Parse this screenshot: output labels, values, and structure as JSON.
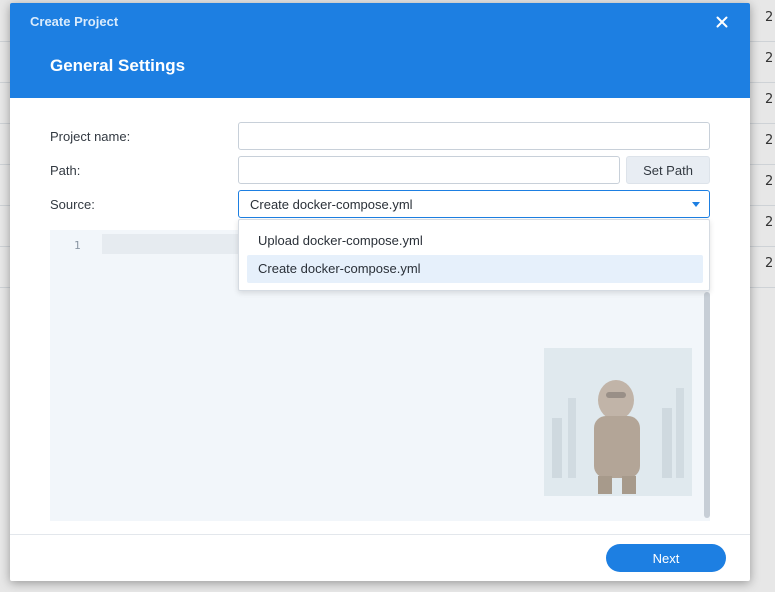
{
  "background": {
    "row_values": [
      "2",
      "2",
      "2",
      "2",
      "2",
      "2",
      "2"
    ]
  },
  "dialog": {
    "title": "Create Project",
    "section_title": "General Settings",
    "close_icon": "close-icon"
  },
  "form": {
    "project_name": {
      "label": "Project name:",
      "value": "",
      "placeholder": ""
    },
    "path": {
      "label": "Path:",
      "value": "",
      "placeholder": "",
      "set_path_label": "Set Path"
    },
    "source": {
      "label": "Source:",
      "selected": "Create docker-compose.yml",
      "options": [
        "Upload docker-compose.yml",
        "Create docker-compose.yml"
      ]
    }
  },
  "editor": {
    "line_numbers": [
      "1"
    ]
  },
  "footer": {
    "next_label": "Next"
  },
  "colors": {
    "accent": "#1d7fe2",
    "header_bg": "#1d7fe2",
    "selected_option_bg": "#e6f0fb"
  }
}
